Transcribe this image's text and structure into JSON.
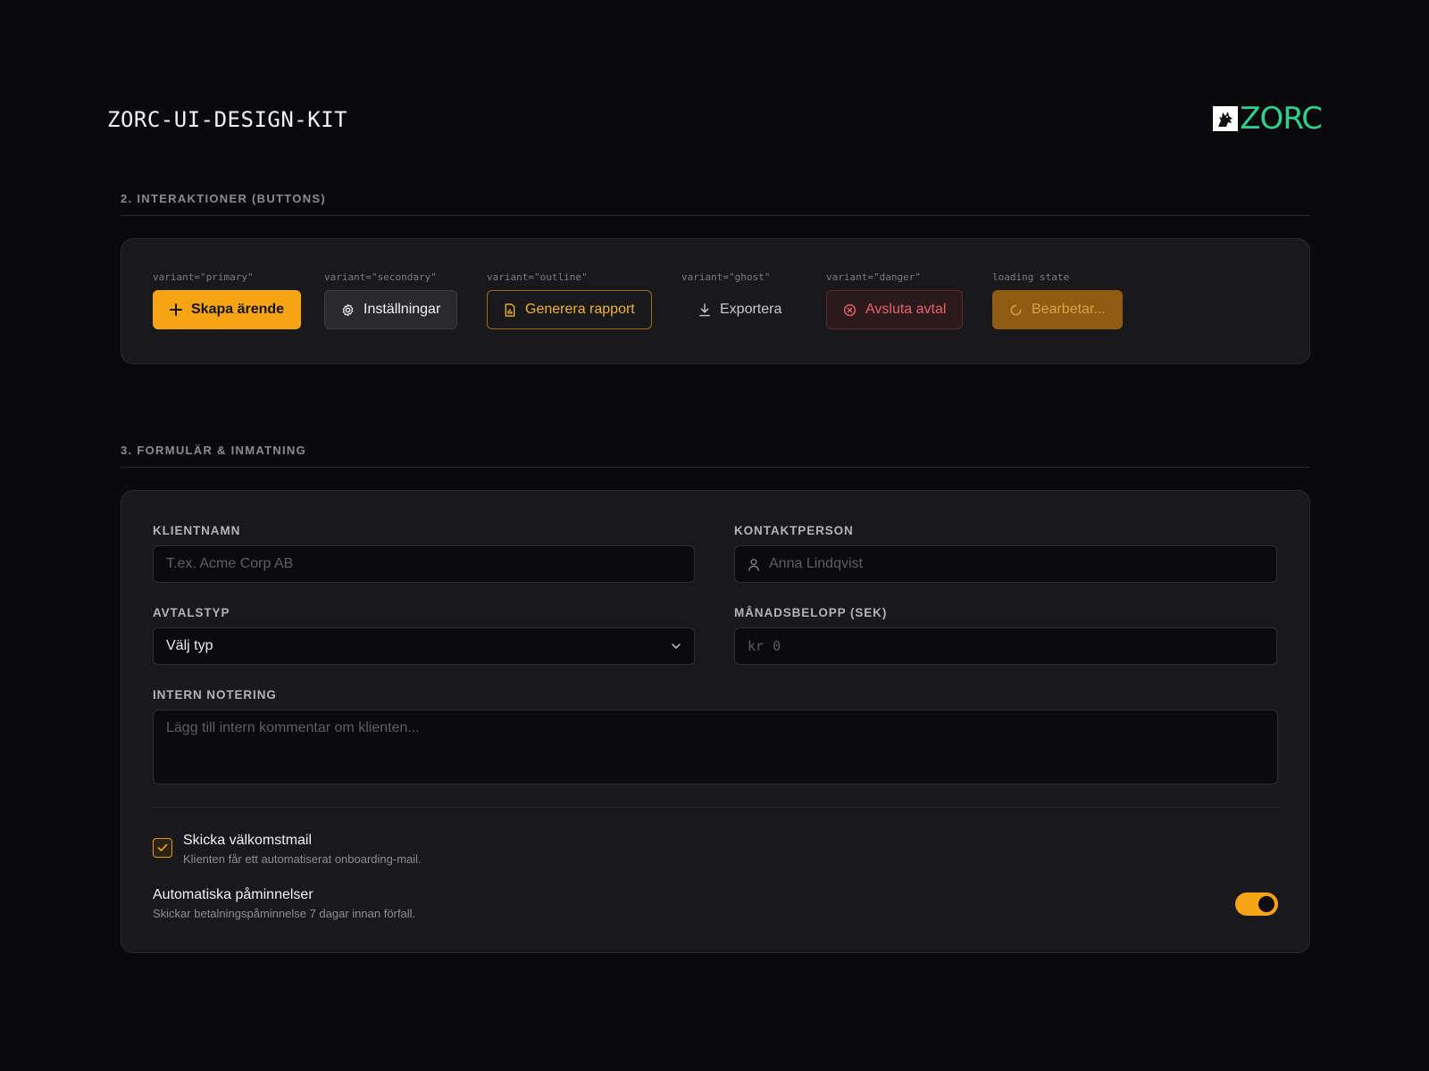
{
  "header": {
    "title": "ZORC-UI-DESIGN-KIT",
    "logo_text": "ZORC",
    "logo_color": "#2fd08f"
  },
  "sections": {
    "buttons_title": "2. INTERAKTIONER (BUTTONS)",
    "form_title": "3. FORMULÄR & INMATNING"
  },
  "buttons": [
    {
      "variant_label": "variant=\"primary\"",
      "label": "Skapa ärende",
      "icon": "plus-icon"
    },
    {
      "variant_label": "variant=\"secondary\"",
      "label": "Inställningar",
      "icon": "gear-icon"
    },
    {
      "variant_label": "variant=\"outline\"",
      "label": "Generera rapport",
      "icon": "report-icon"
    },
    {
      "variant_label": "variant=\"ghost\"",
      "label": "Exportera",
      "icon": "download-icon"
    },
    {
      "variant_label": "variant=\"danger\"",
      "label": "Avsluta avtal",
      "icon": "x-circle-icon"
    },
    {
      "variant_label": "loading state",
      "label": "Bearbetar...",
      "icon": "spinner-icon"
    }
  ],
  "form": {
    "client_name": {
      "label": "KLIENTNAMN",
      "placeholder": "T.ex. Acme Corp AB"
    },
    "contact": {
      "label": "KONTAKTPERSON",
      "placeholder": "Anna Lindqvist",
      "icon": "user-icon"
    },
    "agreement_type": {
      "label": "AVTALSTYP",
      "value": "Välj typ"
    },
    "monthly_amount": {
      "label": "MÅNADSBELOPP (SEK)",
      "prefix": "kr",
      "placeholder": "0"
    },
    "note": {
      "label": "INTERN NOTERING",
      "placeholder": "Lägg till intern kommentar om klienten..."
    },
    "welcome_mail": {
      "title": "Skicka välkomstmail",
      "description": "Klienten får ett automatiserat onboarding-mail.",
      "checked": true
    },
    "reminders": {
      "title": "Automatiska påminnelser",
      "description": "Skickar betalningspåminnelse 7 dagar innan förfall.",
      "enabled": true
    }
  },
  "colors": {
    "accent": "#f6a414",
    "danger": "#e8616b",
    "background": "#0a0a0c",
    "card": "#19191b"
  }
}
